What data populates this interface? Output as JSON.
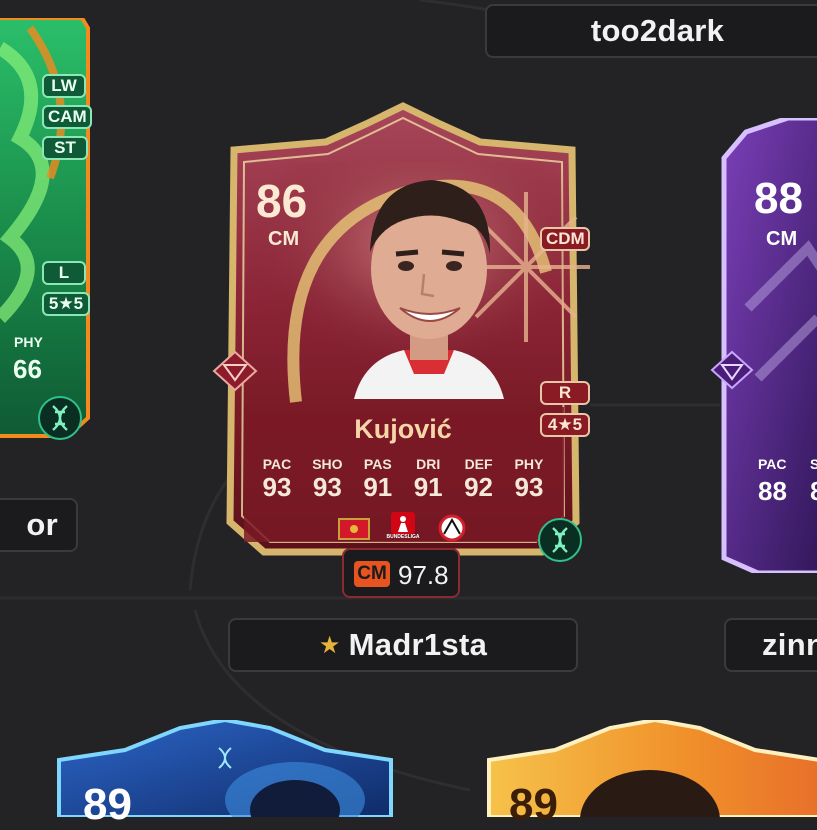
{
  "players": [
    {
      "name": "too2dark"
    },
    {
      "name": "Madr1sta",
      "captain_icon": "star-icon"
    },
    {
      "name_fragment_left": "or"
    },
    {
      "name_fragment_right": "zinn"
    }
  ],
  "main_card": {
    "rating": "86",
    "position": "CM",
    "alt_position": "CDM",
    "player_name": "Kujović",
    "foot": "R",
    "skill_weak": "4★5",
    "stats": [
      {
        "label": "PAC",
        "value": "93"
      },
      {
        "label": "SHO",
        "value": "93"
      },
      {
        "label": "PAS",
        "value": "91"
      },
      {
        "label": "DRI",
        "value": "91"
      },
      {
        "label": "DEF",
        "value": "92"
      },
      {
        "label": "PHY",
        "value": "93"
      }
    ],
    "league_text": "BUNDESLIGA",
    "chem_badge": {
      "position": "CM",
      "value": "97.8"
    },
    "icons": [
      "gem-icon",
      "montenegro-flag-icon",
      "bundesliga-logo-icon",
      "club-crest-icon",
      "dna-icon"
    ],
    "colors": {
      "frame": "#d6b56c",
      "body": "#7a1a26",
      "badge": "#e8541f"
    }
  },
  "left_card": {
    "positions": [
      "LW",
      "CAM",
      "ST"
    ],
    "foot": "L",
    "skill_weak": "5★5",
    "stat": {
      "label": "PHY",
      "value": "66"
    },
    "colors": {
      "primary": "#1fa35b",
      "accent": "#f28a1e"
    }
  },
  "right_card": {
    "rating": "88",
    "position": "CM",
    "stats": [
      {
        "label": "PAC",
        "value": "88"
      },
      {
        "label": "S",
        "value": "8"
      }
    ],
    "colors": {
      "primary": "#5b2a8e"
    }
  },
  "bottom_cards": [
    {
      "rating": "89",
      "colors": {
        "primary": "#1d3f8a"
      }
    },
    {
      "rating": "89",
      "colors": {
        "primary": "#f0a12a"
      }
    }
  ]
}
